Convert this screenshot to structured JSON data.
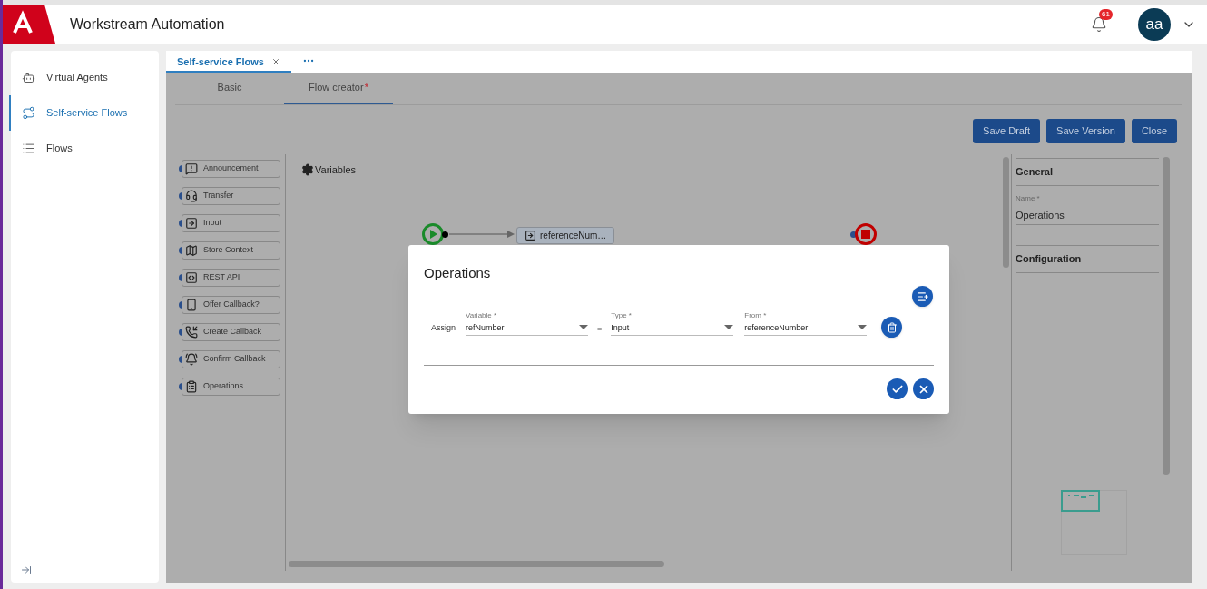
{
  "app": {
    "title": "Workstream Automation",
    "notifications": "61",
    "avatar": "aa"
  },
  "sidebar": {
    "items": [
      {
        "label": "Virtual Agents",
        "selected": false
      },
      {
        "label": "Self-service Flows",
        "selected": true
      },
      {
        "label": "Flows",
        "selected": false
      }
    ]
  },
  "open_tabs": [
    {
      "label": "Self-service Flows",
      "selected": true
    }
  ],
  "editor_tabs": [
    {
      "label": "Basic",
      "selected": false
    },
    {
      "label": "Flow creator",
      "mark": "*",
      "selected": true
    }
  ],
  "actions": [
    "Save Draft",
    "Save Version",
    "Close"
  ],
  "palette": [
    {
      "label": "Announcement"
    },
    {
      "label": "Transfer"
    },
    {
      "label": "Input"
    },
    {
      "label": "Store Context"
    },
    {
      "label": "REST API"
    },
    {
      "label": "Offer Callback?"
    },
    {
      "label": "Create Callback"
    },
    {
      "label": "Confirm Callback"
    },
    {
      "label": "Operations"
    }
  ],
  "canvas": {
    "variables_label": "Variables",
    "nodes": [
      {
        "kind": "start"
      },
      {
        "kind": "step",
        "label": "referenceNum…"
      },
      {
        "kind": "end"
      }
    ]
  },
  "properties": {
    "sections": [
      {
        "title": "General",
        "fields": [
          {
            "label": "Name *",
            "value": "Operations"
          }
        ]
      },
      {
        "title": "Configuration"
      }
    ]
  },
  "dialog": {
    "title": "Operations",
    "rows": [
      {
        "label": "Assign",
        "operator": "=",
        "fields": [
          {
            "label": "Variable *",
            "value": "refNumber"
          },
          {
            "label": "Type *",
            "value": "Input"
          },
          {
            "label": "From *",
            "value": "referenceNumber"
          }
        ]
      }
    ]
  }
}
